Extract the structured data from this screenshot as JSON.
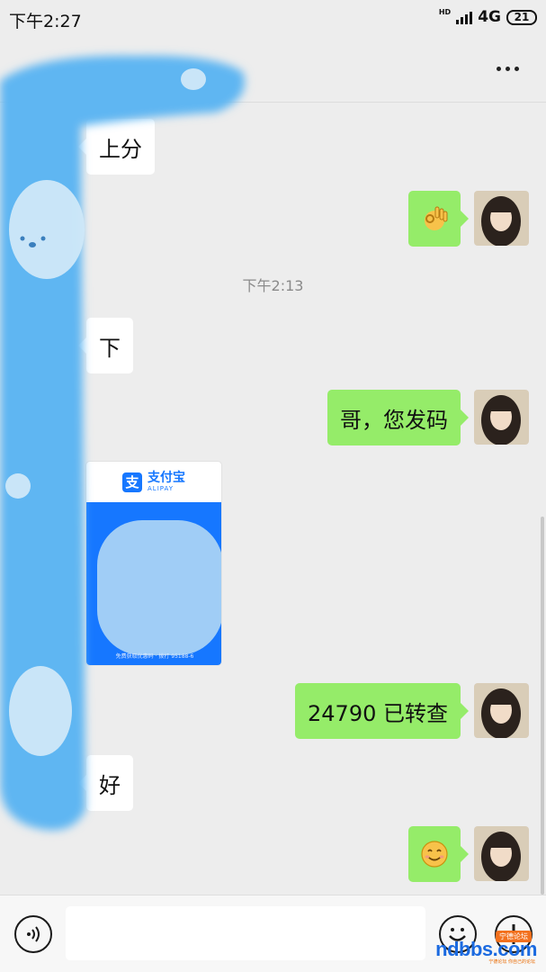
{
  "status_bar": {
    "time": "下午2:27",
    "hd_label": "HD",
    "network": "4G",
    "battery": "21"
  },
  "nav": {
    "more_icon": "more-dots-icon"
  },
  "messages": [
    {
      "side": "in",
      "type": "text",
      "text": "上分"
    },
    {
      "side": "out",
      "type": "emoji",
      "emoji": "ok-hand-emoji"
    },
    {
      "side": "timestamp",
      "text": "下午2:13"
    },
    {
      "side": "in",
      "type": "text",
      "text": "下"
    },
    {
      "side": "out",
      "type": "text",
      "text": "哥，您发码"
    },
    {
      "side": "in",
      "type": "image",
      "card": {
        "brand_cn": "支付宝",
        "brand_en": "ALIPAY",
        "footer": "免费获取优惠码 · 拨打 95188-6"
      }
    },
    {
      "side": "out",
      "type": "text",
      "text": "24790 已转查"
    },
    {
      "side": "in",
      "type": "text",
      "text": "好"
    },
    {
      "side": "out",
      "type": "emoji",
      "emoji": "smile-emoji"
    }
  ],
  "input_bar": {
    "voice_icon": "voice-icon",
    "message_value": "",
    "emoji_icon": "emoji-face-icon",
    "add_icon": "plus-icon"
  },
  "watermark": {
    "text": "ndbbs.com",
    "badge": "宁德论坛",
    "sub": "宁德论坛 你自己的论坛"
  },
  "colors": {
    "background": "#ededed",
    "outgoing_bubble": "#95ec69",
    "incoming_bubble": "#ffffff",
    "alipay_blue": "#1677ff"
  }
}
